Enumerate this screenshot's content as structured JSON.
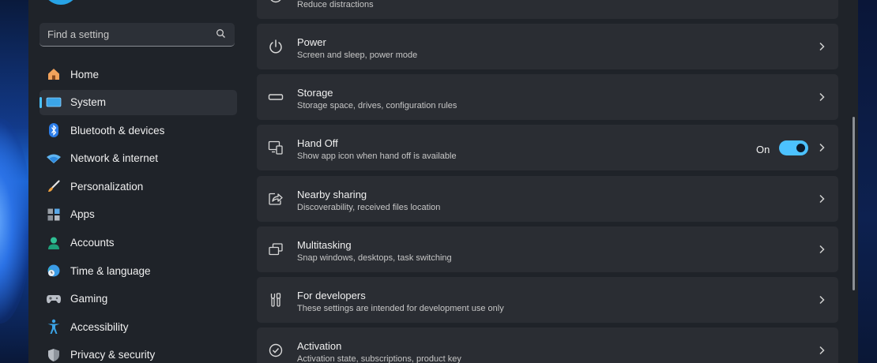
{
  "search": {
    "placeholder": "Find a setting"
  },
  "sidebar": {
    "items": [
      {
        "label": "Home",
        "icon": "home-icon"
      },
      {
        "label": "System",
        "icon": "system-icon",
        "active": true
      },
      {
        "label": "Bluetooth & devices",
        "icon": "bluetooth-icon"
      },
      {
        "label": "Network & internet",
        "icon": "wifi-icon"
      },
      {
        "label": "Personalization",
        "icon": "brush-icon"
      },
      {
        "label": "Apps",
        "icon": "apps-icon"
      },
      {
        "label": "Accounts",
        "icon": "account-icon"
      },
      {
        "label": "Time & language",
        "icon": "clock-globe-icon"
      },
      {
        "label": "Gaming",
        "icon": "gamepad-icon"
      },
      {
        "label": "Accessibility",
        "icon": "accessibility-icon"
      },
      {
        "label": "Privacy & security",
        "icon": "shield-icon"
      }
    ]
  },
  "settings": {
    "cards": [
      {
        "title": "",
        "subtitle": "Reduce distractions",
        "icon": "focus-icon"
      },
      {
        "title": "Power",
        "subtitle": "Screen and sleep, power mode",
        "icon": "power-icon"
      },
      {
        "title": "Storage",
        "subtitle": "Storage space, drives, configuration rules",
        "icon": "storage-icon"
      },
      {
        "title": "Hand Off",
        "subtitle": "Show app icon when hand off is available",
        "icon": "hand-off-icon",
        "toggle": {
          "state_label": "On",
          "on": true
        }
      },
      {
        "title": "Nearby sharing",
        "subtitle": "Discoverability, received files location",
        "icon": "share-icon"
      },
      {
        "title": "Multitasking",
        "subtitle": "Snap windows, desktops, task switching",
        "icon": "multitasking-icon"
      },
      {
        "title": "For developers",
        "subtitle": "These settings are intended for development use only",
        "icon": "developer-tools-icon"
      },
      {
        "title": "Activation",
        "subtitle": "Activation state, subscriptions, product key",
        "icon": "activation-icon"
      }
    ]
  },
  "colors": {
    "accent": "#4cc2ff",
    "window_bg": "#1f2329",
    "card_bg": "#2a2d33"
  }
}
